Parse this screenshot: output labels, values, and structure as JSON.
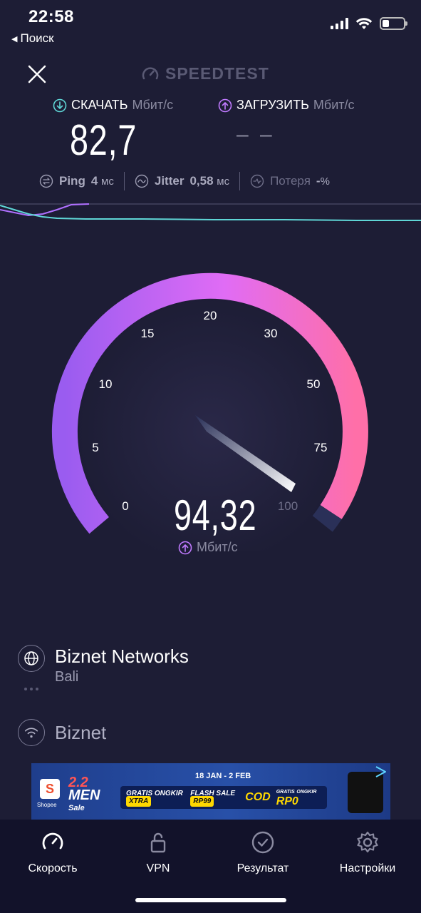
{
  "status_bar": {
    "time": "22:58",
    "back_label": "Поиск"
  },
  "header": {
    "logo": "SPEEDTEST"
  },
  "download": {
    "label": "СКАЧАТЬ",
    "unit": "Мбит/с",
    "value": "82,7"
  },
  "upload": {
    "label": "ЗАГРУЗИТЬ",
    "unit": "Мбит/с",
    "value": "– –"
  },
  "stats": {
    "ping": {
      "name": "Ping",
      "value": "4",
      "unit": "мс"
    },
    "jitter": {
      "name": "Jitter",
      "value": "0,58",
      "unit": "мс"
    },
    "loss": {
      "name": "Потеря",
      "value": "-",
      "unit": "%"
    }
  },
  "gauge": {
    "ticks": [
      "0",
      "5",
      "10",
      "15",
      "20",
      "30",
      "50",
      "75",
      "100"
    ],
    "value": "94,32",
    "unit": "Мбит/с"
  },
  "server": {
    "name": "Biznet Networks",
    "location": "Bali"
  },
  "provider": {
    "name": "Biznet"
  },
  "ad": {
    "date": "18 JAN - 2 FEB",
    "brand": "Shopee",
    "promo_num": "2.2",
    "promo_title": "MEN",
    "promo_sub": "Sale",
    "chip1_a": "GRATIS",
    "chip1_b": "ONGKIR",
    "chip1_c": "XTRA",
    "chip2_a": "FLASH SALE",
    "chip2_b": "RP99",
    "chip3": "COD",
    "chip4_a": "GRATIS",
    "chip4_b": "ONGKIR",
    "chip4_c": "RP0"
  },
  "tabs": [
    {
      "label": "Скорость",
      "icon": "speedometer-icon",
      "active": true
    },
    {
      "label": "VPN",
      "icon": "lock-icon"
    },
    {
      "label": "Результат",
      "icon": "check-circle-icon"
    },
    {
      "label": "Настройки",
      "icon": "gear-icon"
    }
  ],
  "colors": {
    "background": "#1d1d35",
    "gauge_start": "#9a5cf0",
    "gauge_end": "#ff6fa8",
    "accent_cyan": "#5fd6d6",
    "accent_purple": "#c07aff"
  }
}
